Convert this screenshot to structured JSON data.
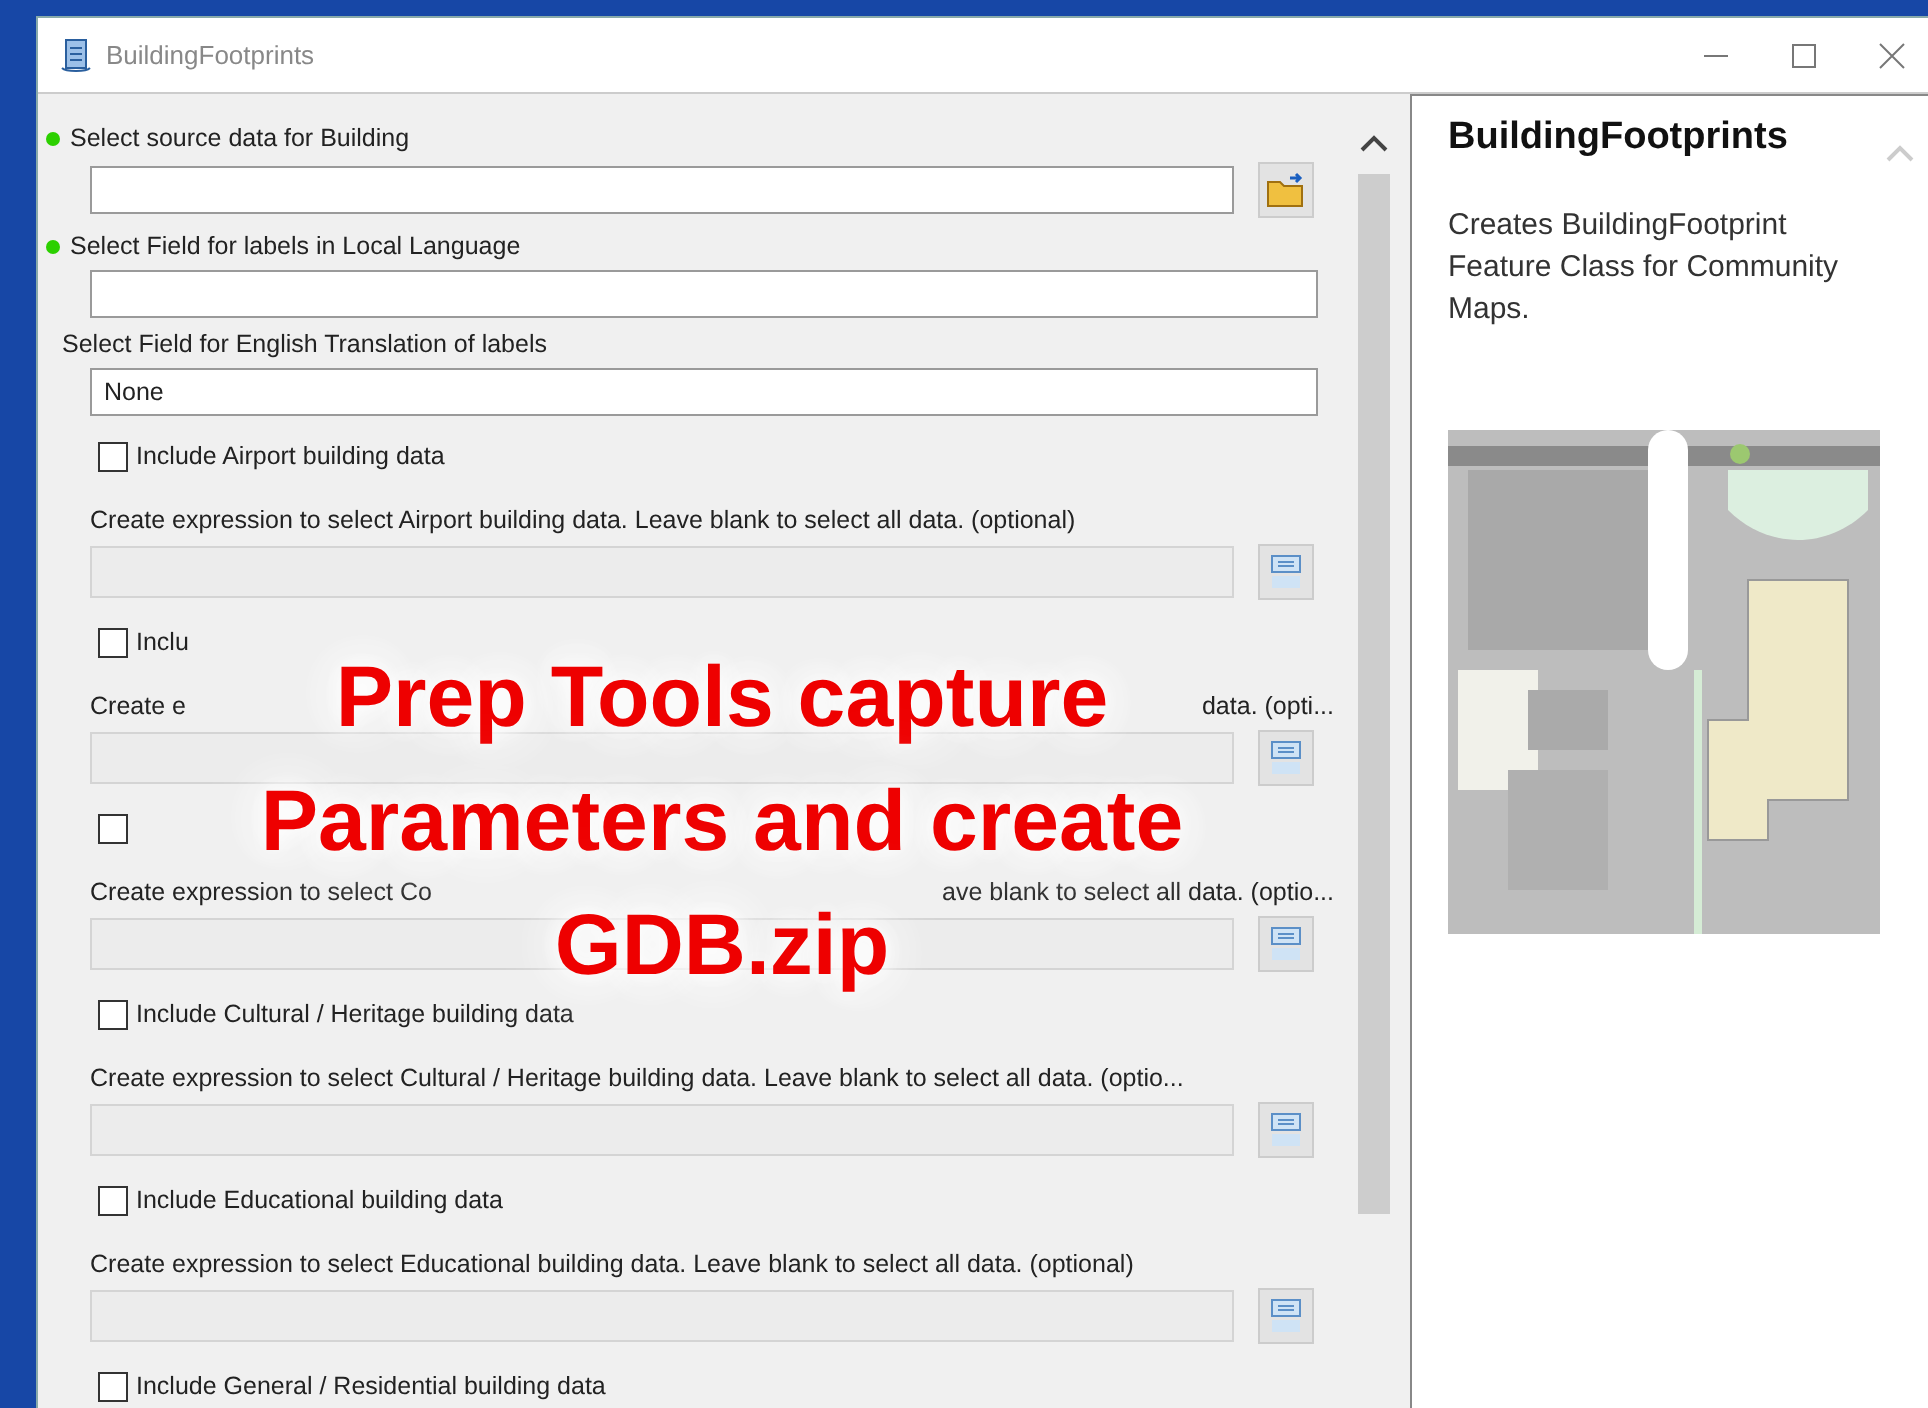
{
  "window": {
    "title": "BuildingFootprints"
  },
  "parameters": [
    {
      "kind": "dataset",
      "required": true,
      "label": "Select source data for Building"
    },
    {
      "kind": "field",
      "required": true,
      "label": "Select Field for labels in Local Language"
    },
    {
      "kind": "field",
      "required": false,
      "label": "Select Field for English Translation of labels",
      "value": "None"
    },
    {
      "kind": "checkbox",
      "checked": false,
      "label": "Include Airport building data"
    },
    {
      "kind": "expression",
      "disabled": true,
      "label_parts": [
        "Create expression to select Airport building data. Leave blank to select all data. (optional)"
      ]
    },
    {
      "kind": "checkbox",
      "checked": false,
      "label": "Inclu"
    },
    {
      "kind": "expression",
      "disabled": true,
      "label_parts": [
        "Create e",
        "data. (opti..."
      ]
    },
    {
      "kind": "checkbox",
      "checked": false
    },
    {
      "kind": "expression",
      "disabled": true,
      "label_parts": [
        "Create expression to select Co",
        "ave blank to select all data. (optio..."
      ]
    },
    {
      "kind": "checkbox",
      "checked": false,
      "label": "Include Cultural / Heritage building data"
    },
    {
      "kind": "expression",
      "disabled": true,
      "label_parts": [
        "Create expression to select Cultural / Heritage building data. Leave blank to select all data. (optio..."
      ]
    },
    {
      "kind": "checkbox",
      "checked": false,
      "label": "Include Educational building data"
    },
    {
      "kind": "expression",
      "disabled": true,
      "label_parts": [
        "Create expression to select Educational building data. Leave blank to select all data. (optional)"
      ]
    },
    {
      "kind": "checkbox",
      "checked": false,
      "label": "Include General / Residential building data"
    }
  ],
  "help": {
    "title": "BuildingFootprints",
    "description": "Creates BuildingFootprint Feature Class for Community Maps."
  },
  "overlay": {
    "lines": [
      "Prep Tools capture",
      "Parameters and create",
      "GDB.zip"
    ]
  }
}
